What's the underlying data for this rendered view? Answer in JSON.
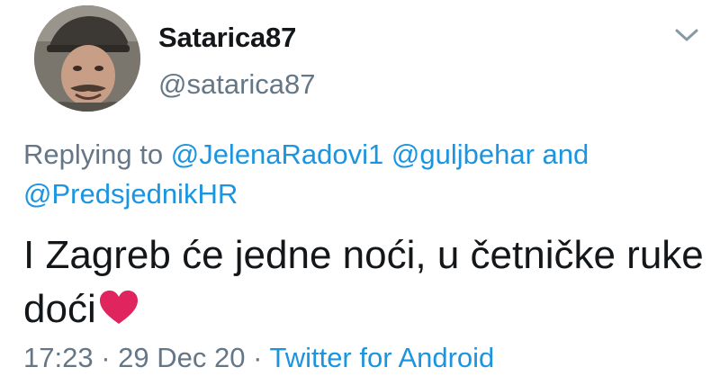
{
  "author": {
    "display_name": "Satarica87",
    "handle": "@satarica87"
  },
  "reply": {
    "prefix": "Replying to",
    "mentions": [
      "@JelenaRadovi1",
      "@guljbehar",
      "@PredsjednikHR"
    ],
    "conjunction": "and"
  },
  "tweet": {
    "text": "I Zagreb će jedne noći, u četničke ruke doći",
    "emoji": "red-heart"
  },
  "meta": {
    "time": "17:23",
    "separator": " · ",
    "date": "29 Dec 20",
    "source": "Twitter for Android"
  },
  "colors": {
    "link": "#1b95e0",
    "secondary": "#657786",
    "heart": "#e0245e"
  },
  "icons": {
    "menu": "chevron-down-icon"
  }
}
